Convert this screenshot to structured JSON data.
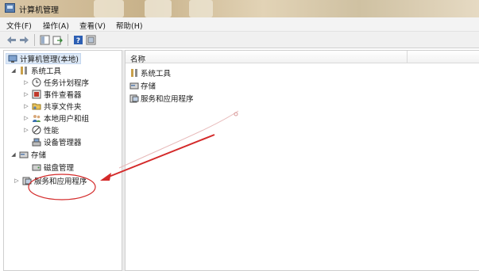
{
  "window": {
    "title": "计算机管理"
  },
  "menu": [
    "文件(F)",
    "操作(A)",
    "查看(V)",
    "帮助(H)"
  ],
  "toolbar": [
    "back-icon",
    "forward-icon",
    "show-tree-icon",
    "export-icon",
    "help-icon",
    "properties-icon"
  ],
  "tree": {
    "root": "计算机管理(本地)",
    "system_tools": {
      "label": "系统工具",
      "children": [
        "任务计划程序",
        "事件查看器",
        "共享文件夹",
        "本地用户和组",
        "性能",
        "设备管理器"
      ]
    },
    "storage": {
      "label": "存储",
      "children": [
        "磁盘管理"
      ]
    },
    "services": {
      "label": "服务和应用程序"
    }
  },
  "list": {
    "column": "名称",
    "items": [
      "系统工具",
      "存储",
      "服务和应用程序"
    ]
  },
  "colors": {
    "annotation": "#d42a2a",
    "selection": "#dde9f7"
  }
}
